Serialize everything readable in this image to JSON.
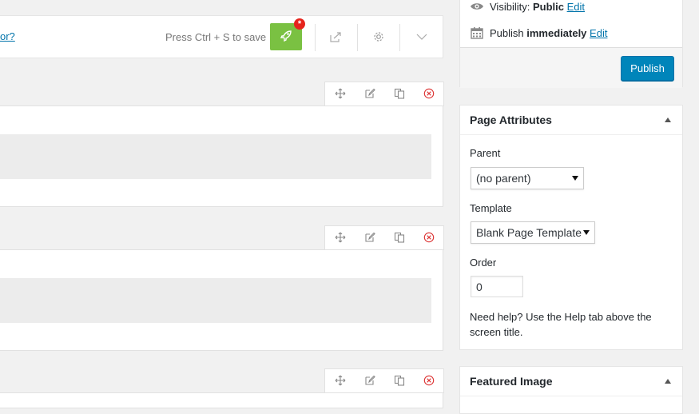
{
  "toolbar": {
    "cut_link": "or?",
    "save_hint": "Press Ctrl + S to save",
    "badge": "*",
    "icons": [
      "rocket-icon",
      "export-icon",
      "gear-icon",
      "chevron-down-icon"
    ]
  },
  "row_tools": [
    "move-icon",
    "edit-icon",
    "copy-icon",
    "delete-icon"
  ],
  "publish": {
    "visibility_label": "Visibility:",
    "visibility_value": "Public",
    "visibility_edit": "Edit",
    "publish_label": "Publish",
    "publish_value": "immediately",
    "publish_edit": "Edit",
    "button": "Publish"
  },
  "page_attributes": {
    "title": "Page Attributes",
    "parent_label": "Parent",
    "parent_value": "(no parent)",
    "template_label": "Template",
    "template_value": "Blank Page Template",
    "order_label": "Order",
    "order_value": "0",
    "help": "Need help? Use the Help tab above the screen title."
  },
  "featured_image": {
    "title": "Featured Image"
  },
  "colors": {
    "rocket_green": "#7ac142",
    "badge_red": "#e6241c",
    "publish_blue": "#0085ba",
    "link_blue": "#0073aa",
    "delete_red": "#dc3232"
  }
}
